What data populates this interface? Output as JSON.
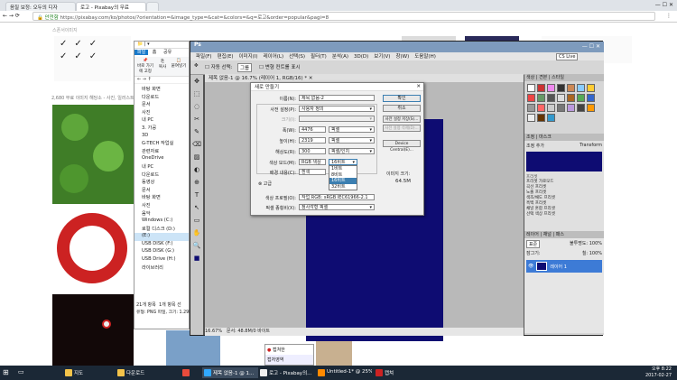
{
  "browser": {
    "tabs": [
      {
        "label": "음질 보정: 오두의 디자",
        "active": false
      },
      {
        "label": "로고 - Pixabay의 무료",
        "active": true
      },
      {
        "label": "",
        "active": false
      }
    ],
    "secure_label": "안전함",
    "url": "https://pixabay.com/ko/photos/?orientation=&image_type=&cat=&colors=&q=로고&order=popular&pagi=8"
  },
  "pixabay": {
    "result_text": "2,680 무료 이미지 해당소 - 사진, 일러스트레",
    "page_strip_text": "스폰서이미지",
    "image_size_text": "유형: PNG 파일, 크기: 1.29MB",
    "item_count": "21개 항목",
    "selected_count": "1개 항목 선"
  },
  "explorer": {
    "ribbon_tabs": [
      "파일",
      "홈",
      "공유"
    ],
    "ribbon_btns": [
      "바로 가기에 고정",
      "복사",
      "붙여넣기"
    ],
    "nav_items": [
      "바탕 화면",
      "다운로드",
      "문서",
      "사진",
      "내 PC",
      "3. 가공",
      "3D",
      "G-TECH 작업실",
      "관련자료",
      "OneDrive",
      "내 PC",
      "다운로드",
      "동영상",
      "문서",
      "바탕 화면",
      "사진",
      "음악",
      "Windows (C:)",
      "로컬 디스크 (D:)",
      "(E:)",
      "USB DISK (F:)",
      "USB DISK (G:)",
      "USB Drive (H:)",
      "라이브러리"
    ]
  },
  "photoshop": {
    "menu": [
      "파일(F)",
      "편집(E)",
      "이미지(I)",
      "레이어(L)",
      "선택(S)",
      "필터(T)",
      "분석(A)",
      "3D(D)",
      "보기(V)",
      "창(W)",
      "도움말(H)"
    ],
    "options": [
      "자동 선택:",
      "그룹",
      "변형 컨트롤 표시"
    ],
    "cslive": "CS Live",
    "doc_tab": "제목 없음-1 @ 16.7% (레이어 1, RGB/16) *",
    "zoom": "16.67%",
    "doc_info": "문서: 48.8M/0 바이트",
    "panel_tabs": [
      "색상",
      "견본",
      "스타일"
    ],
    "adjust_tabs": [
      "조정",
      "마스크"
    ],
    "adjust_labels": [
      "조정 추가"
    ],
    "transform_label": "Transform",
    "preset_label": "프리셋",
    "presets": [
      "프리셋 가로모드",
      "곡선 프리셋",
      "노출 프리셋",
      "색조/채도 프리셋",
      "흑백 프리셋",
      "채널 혼합 프리셋",
      "선택 색상 프리셋"
    ],
    "layers_tabs": [
      "레이어",
      "채널",
      "패스"
    ],
    "blend_mode": "표준",
    "opacity": "불투명도:",
    "opacity_value": "100%",
    "fill": "칠:",
    "fill_value": "100%",
    "lock": "잠그기:",
    "layer_name": "레이어 1"
  },
  "dialog": {
    "title": "새로 만들기",
    "name_label": "이름(N):",
    "name_value": "제목 없음-2",
    "preset_label": "사전 설정(P):",
    "preset_value": "사용자 정의",
    "size_label": "크기(I):",
    "width_label": "폭(W):",
    "width_value": "4476",
    "width_unit": "픽셀",
    "height_label": "높이(H):",
    "height_value": "2319",
    "height_unit": "픽셀",
    "res_label": "해상도(R):",
    "res_value": "300",
    "res_unit": "픽셀/인치",
    "mode_label": "색상 모드(M):",
    "mode_value": "RGB 색상",
    "bits_value": "16비트",
    "bg_label": "배경 내용(C):",
    "bg_value": "흰색",
    "advanced_label": "고급",
    "profile_label": "색상 프로필(O):",
    "profile_value": "작업 RGB: sRGB IEC61966-2.1",
    "aspect_label": "픽셀 종횡비(X):",
    "aspect_value": "정사각형 픽셀",
    "ok": "확인",
    "cancel": "취소",
    "save_preset": "사전 설정 저장(S)...",
    "delete_preset": "사전 설정 삭제(D)...",
    "device_central": "Device Central(E)...",
    "image_size_label": "이미지 크기:",
    "image_size_value": "64.5M",
    "bits_options": [
      "1비트",
      "8비트",
      "16비트",
      "32비트"
    ],
    "bits_highlight": 2
  },
  "popup": {
    "title": "캡쳐한",
    "sub": "캡처영역"
  },
  "taskbar": {
    "items": [
      {
        "label": "지도",
        "active": false
      },
      {
        "label": "다운로드",
        "active": false
      },
      {
        "label": "",
        "active": false
      },
      {
        "label": "제목 없음-1 @ 1...",
        "active": true
      },
      {
        "label": "로고 - Pixabay의...",
        "active": false
      },
      {
        "label": "Untitled-1* @ 25%...",
        "active": false
      },
      {
        "label": "캡쳐",
        "active": false
      }
    ],
    "time": "오후 8:22",
    "date": "2017-02-27"
  }
}
